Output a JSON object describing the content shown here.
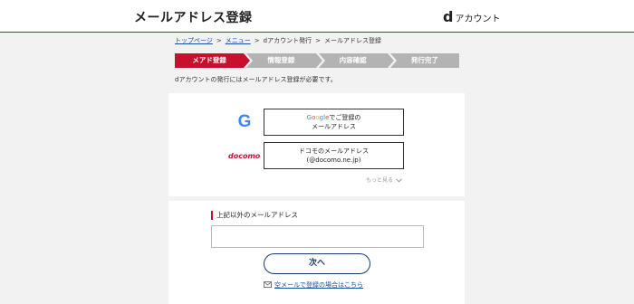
{
  "header": {
    "title": "メールアドレス登録",
    "brand_d": "d",
    "brand_text": "アカウント"
  },
  "breadcrumb": {
    "items": [
      "トップページ",
      "メニュー",
      "dアカウント発行",
      "メールアドレス登録"
    ],
    "separator": ">"
  },
  "steps": [
    {
      "label": "メアド登録",
      "active": true
    },
    {
      "label": "情報登録",
      "active": false
    },
    {
      "label": "内容確認",
      "active": false
    },
    {
      "label": "発行完了",
      "active": false
    }
  ],
  "notice": "dアカウントの発行にはメールアドレス登録が必要です。",
  "google_button": {
    "line1_suffix": "でご登録の",
    "line2": "メールアドレス",
    "brand": [
      "G",
      "o",
      "o",
      "g",
      "l",
      "e"
    ]
  },
  "docomo_logo": "docomo",
  "docomo_button": {
    "line1": "ドコモのメールアドレス",
    "line2": "(@docomo.ne.jp)"
  },
  "more_link": "もっと見る",
  "other_email": {
    "label": "上記以外のメールアドレス",
    "value": "",
    "placeholder": ""
  },
  "next_button": "次へ",
  "empty_mail_link": "空メールで登録の場合はこちら",
  "icons": {
    "google": "google-icon",
    "chevron": "chevron-down-icon",
    "mail": "mail-icon"
  },
  "colors": {
    "accent": "#c8102e",
    "link": "#1a4fa0",
    "step_inactive": "#b3b3b3"
  }
}
